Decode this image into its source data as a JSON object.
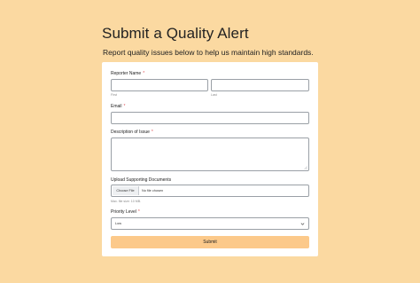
{
  "header": {
    "title": "Submit a Quality Alert",
    "subtitle": "Report quality issues below to help us maintain high standards."
  },
  "form": {
    "reporter": {
      "label": "Reporter Name",
      "required_mark": "*",
      "first_hint": "First",
      "last_hint": "Last",
      "first_value": "",
      "last_value": ""
    },
    "email": {
      "label": "Email",
      "required_mark": "*",
      "value": ""
    },
    "description": {
      "label": "Description of Issue",
      "required_mark": "*",
      "value": ""
    },
    "upload": {
      "label": "Upload Supporting Documents",
      "button_label": "Choose File",
      "status": "No file chosen",
      "hint": "Max. file size: 10 MB."
    },
    "priority": {
      "label": "Priority Level",
      "required_mark": "*",
      "selected": "Low"
    },
    "submit_label": "Submit"
  },
  "colors": {
    "background": "#fbd9a1",
    "submit": "#fcc98a",
    "required": "#e0545a"
  }
}
